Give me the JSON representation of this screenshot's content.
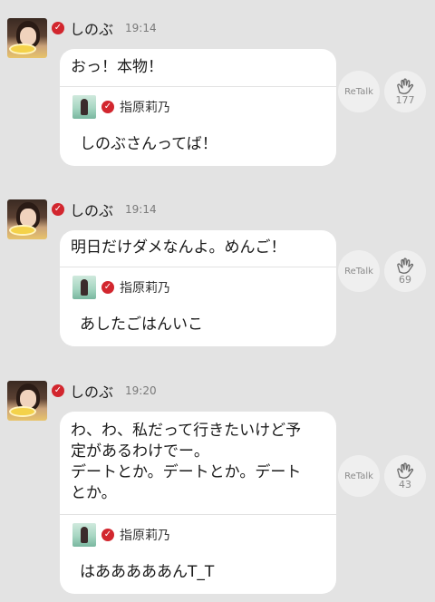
{
  "posts": [
    {
      "author": "しのぶ",
      "time": "19:14",
      "message": "おっ！本物！",
      "quote": {
        "author": "指原莉乃",
        "text": "しのぶさんってば！"
      },
      "retalk_label": "ReTalk",
      "clap_count": "177"
    },
    {
      "author": "しのぶ",
      "time": "19:14",
      "message": "明日だけダメなんよ。めんご！",
      "quote": {
        "author": "指原莉乃",
        "text": "あしたごはんいこ"
      },
      "retalk_label": "ReTalk",
      "clap_count": "69"
    },
    {
      "author": "しのぶ",
      "time": "19:20",
      "message": "わ、わ、私だって行きたいけど予\n定があるわけでー。\nデートとか。デートとか。デート\nとか。",
      "quote": {
        "author": "指原莉乃",
        "text": "はあああああんT_T"
      },
      "retalk_label": "ReTalk",
      "clap_count": "43"
    }
  ],
  "icons": {
    "verified": "check-badge-icon",
    "clap": "clap-hands-icon"
  },
  "colors": {
    "background": "#e3e3e3",
    "bubble": "#ffffff",
    "verified_badge": "#d2262e",
    "muted_text": "#7a7a7a"
  }
}
